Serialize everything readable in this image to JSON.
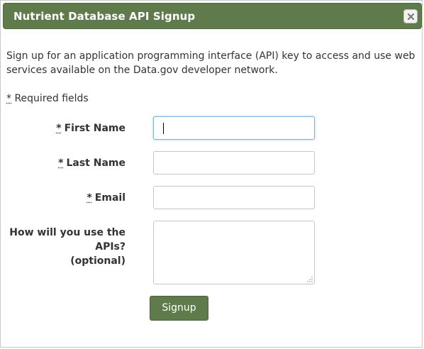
{
  "dialog": {
    "title": "Nutrient Database API Signup",
    "close_icon": "close-icon",
    "accent_color": "#5f7b4b"
  },
  "intro": {
    "text": "Sign up for an application programming interface (API) key to access and use web services available on the Data.gov developer network."
  },
  "required_note": {
    "star": "*",
    "text": "Required fields"
  },
  "form": {
    "first_name": {
      "star": "*",
      "label": "First Name",
      "value": ""
    },
    "last_name": {
      "star": "*",
      "label": "Last Name",
      "value": ""
    },
    "email": {
      "star": "*",
      "label": "Email",
      "value": ""
    },
    "usage": {
      "label_line1": "How will you use the",
      "label_line2": "APIs?",
      "label_line3": "(optional)",
      "value": ""
    },
    "submit_label": "Signup"
  }
}
